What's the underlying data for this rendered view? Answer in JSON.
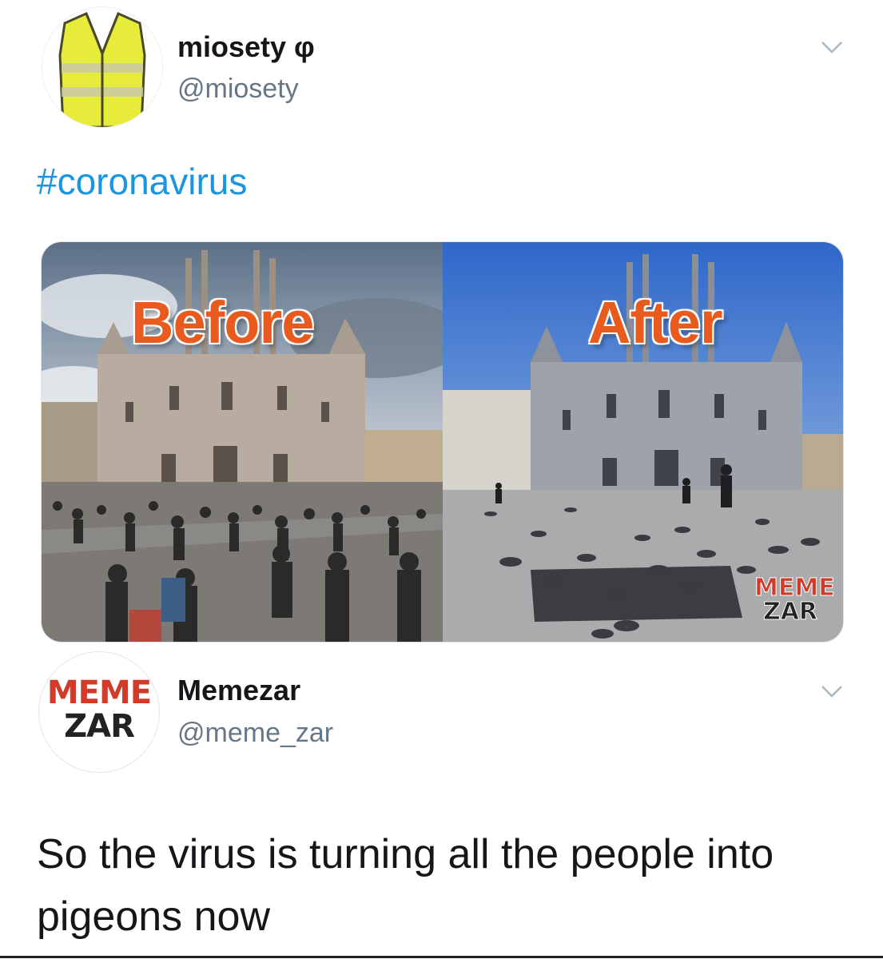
{
  "tweet": {
    "author_name": "miosety φ",
    "author_handle": "@miosety",
    "hashtag": "#coronavirus",
    "media": {
      "before_label": "Before",
      "after_label": "After",
      "watermark_top": "MEME",
      "watermark_bottom": "ZAR"
    }
  },
  "quoted": {
    "author_name": "Memezar",
    "author_handle": "@meme_zar",
    "avatar_top": "MEME",
    "avatar_bottom": "ZAR",
    "text": "So the virus is turning all the people into pigeons now"
  },
  "icons": {
    "menu": "chevron-down-icon",
    "avatar1": "safety-vest-avatar",
    "avatar2": "meme-zar-logo"
  },
  "colors": {
    "link": "#1b95e0",
    "secondary_text": "#657786",
    "label_orange": "#e85a1e"
  }
}
